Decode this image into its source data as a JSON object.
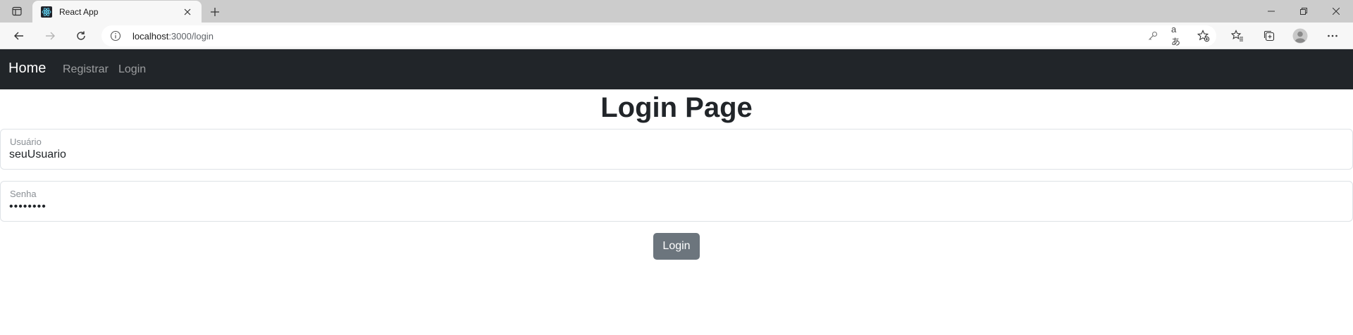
{
  "browser": {
    "tab": {
      "title": "React App",
      "favicon": "react-icon"
    },
    "address": {
      "host": "localhost",
      "path": ":3000/login"
    },
    "icons": [
      "sidebar-tabs-icon",
      "close-icon",
      "plus-icon",
      "minimize-icon",
      "restore-icon",
      "back-icon",
      "forward-icon",
      "refresh-icon",
      "info-icon",
      "key-icon",
      "read-aloud-icon",
      "favorite-add-icon",
      "favorites-icon",
      "collections-icon",
      "profile-icon",
      "more-icon"
    ]
  },
  "navbar": {
    "brand": "Home",
    "links": [
      {
        "label": "Registrar"
      },
      {
        "label": "Login"
      }
    ]
  },
  "main": {
    "title": "Login Page",
    "username": {
      "label": "Usuário",
      "value": "seuUsuario"
    },
    "password": {
      "label": "Senha",
      "value": "••••••••"
    },
    "submit_label": "Login"
  },
  "colors": {
    "navbar_bg": "#212529",
    "button_bg": "#6c757d",
    "react_blue": "#61dafb"
  }
}
